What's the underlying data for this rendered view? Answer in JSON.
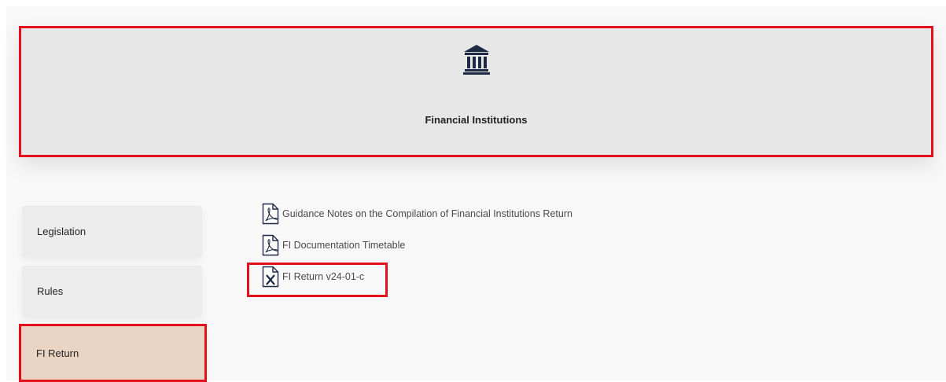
{
  "hero": {
    "icon": "bank-building-icon",
    "title": "Financial Institutions"
  },
  "sidebar": {
    "items": [
      {
        "label": "Legislation",
        "active": false
      },
      {
        "label": "Rules",
        "active": false
      },
      {
        "label": "FI Return",
        "active": true
      }
    ]
  },
  "documents": [
    {
      "label": "Guidance Notes on the Compilation of Financial Institutions Return",
      "icon": "pdf-file-icon"
    },
    {
      "label": "FI Documentation Timetable",
      "icon": "pdf-file-icon"
    },
    {
      "label": "FI Return v24-01-c",
      "icon": "excel-file-icon"
    }
  ],
  "colors": {
    "highlight": "#e3101b",
    "active_tab": "#ead5c5",
    "icon": "#1e2a44"
  }
}
